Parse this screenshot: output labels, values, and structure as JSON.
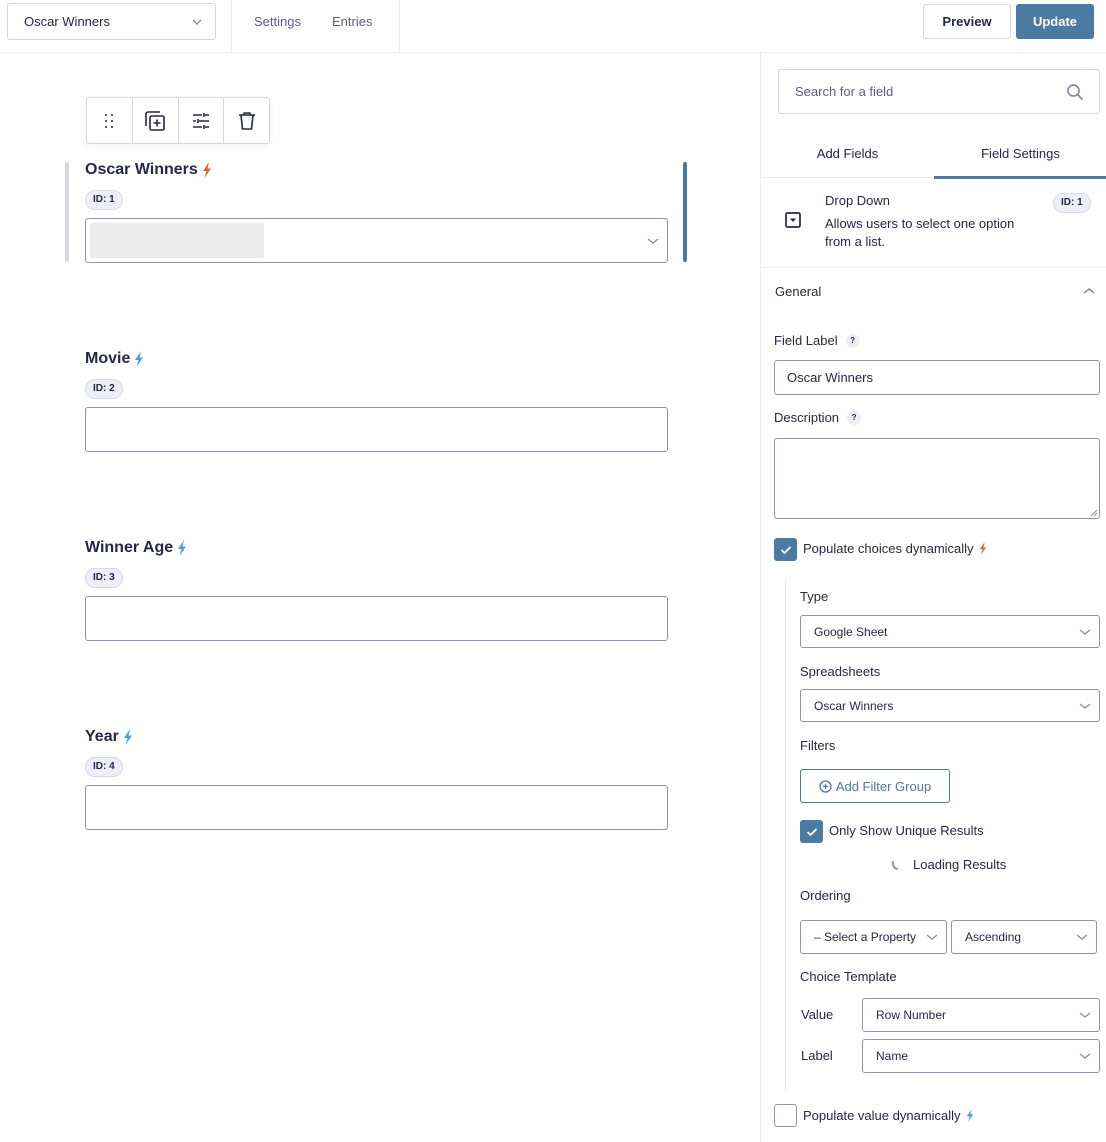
{
  "topbar": {
    "form_selector": "Oscar Winners",
    "nav": [
      "Settings",
      "Entries"
    ],
    "preview_label": "Preview",
    "update_label": "Update"
  },
  "colors": {
    "accent": "#4b7aa2",
    "bolt_active": "#d66a22",
    "bolt_inactive": "#4a9ee8",
    "text": "#242748"
  },
  "editor": {
    "toolbar_icons": [
      "drag-handle-icon",
      "duplicate-icon",
      "settings-sliders-icon",
      "trash-icon"
    ],
    "fields": [
      {
        "label": "Oscar Winners",
        "id_badge": "ID: 1",
        "type": "select",
        "bolt": "active"
      },
      {
        "label": "Movie",
        "id_badge": "ID: 2",
        "type": "text",
        "bolt": "inactive"
      },
      {
        "label": "Winner Age",
        "id_badge": "ID: 3",
        "type": "text",
        "bolt": "inactive"
      },
      {
        "label": "Year",
        "id_badge": "ID: 4",
        "type": "text",
        "bolt": "inactive"
      }
    ]
  },
  "sidebar": {
    "search_placeholder": "Search for a field",
    "tabs": [
      {
        "label": "Add Fields",
        "active": false
      },
      {
        "label": "Field Settings",
        "active": true
      }
    ],
    "field_info": {
      "title": "Drop Down",
      "description": "Allows users to select one option from a list.",
      "id_badge": "ID: 1"
    },
    "general": {
      "heading": "General",
      "field_label": {
        "label": "Field Label",
        "help": "?",
        "value": "Oscar Winners"
      },
      "description": {
        "label": "Description",
        "help": "?",
        "value": ""
      },
      "populate_choices": {
        "label": "Populate choices dynamically",
        "checked": true
      },
      "type": {
        "label": "Type",
        "value": "Google Sheet"
      },
      "spreadsheets": {
        "label": "Spreadsheets",
        "value": "Oscar Winners"
      },
      "filters": {
        "label": "Filters",
        "button": "Add Filter Group"
      },
      "unique_results": {
        "label": "Only Show Unique Results",
        "checked": true
      },
      "loading": "Loading Results",
      "ordering": {
        "label": "Ordering",
        "property": "– Select a Property",
        "direction": "Ascending"
      },
      "choice_template": {
        "label": "Choice Template",
        "value_label": "Value",
        "value": "Row Number",
        "label_label": "Label",
        "label_value": "Name"
      },
      "populate_value": {
        "label": "Populate value dynamically",
        "checked": false
      }
    }
  }
}
